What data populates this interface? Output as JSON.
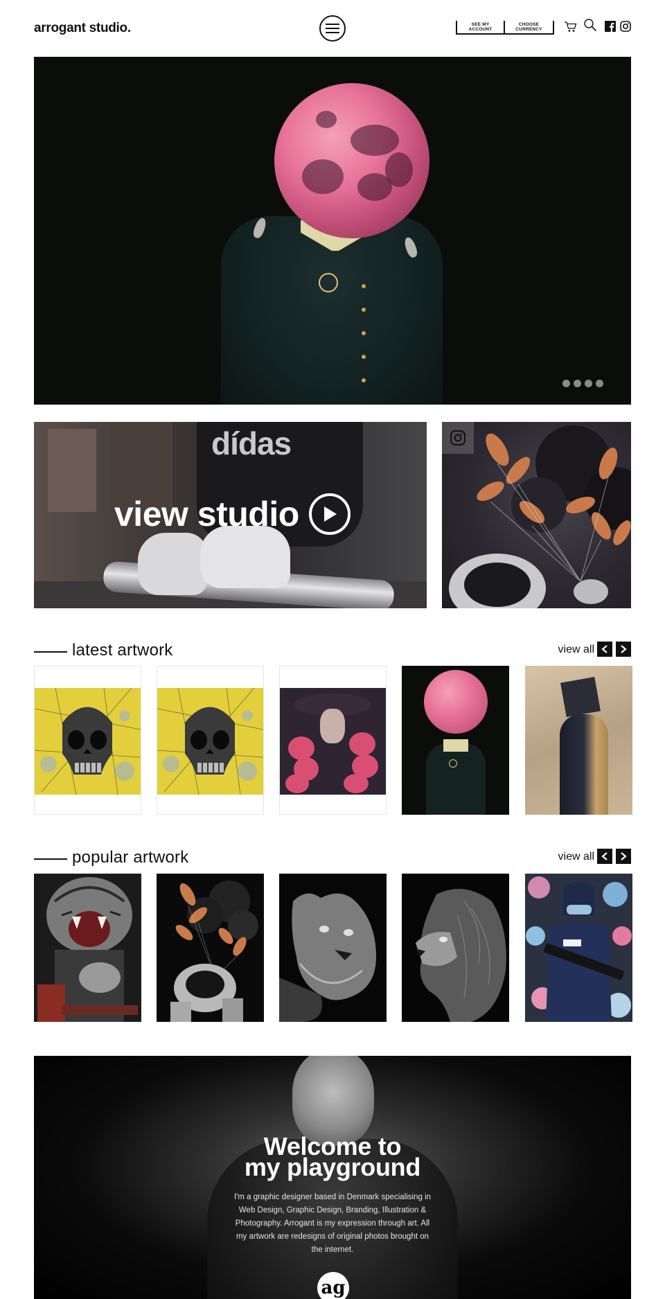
{
  "header": {
    "logo": "arrogant studio.",
    "account_label": "SEE MY\nACCOUNT",
    "currency_label": "CHOOSE\nCURRENCY",
    "icons": [
      "menu-icon",
      "cart-icon",
      "search-icon",
      "facebook-icon",
      "instagram-icon"
    ]
  },
  "hero": {
    "slide_count": 4,
    "active_slide": 1
  },
  "promo": {
    "studio_label": "view studio",
    "instagram_icon": "instagram-icon"
  },
  "latest": {
    "title": "latest artwork",
    "view_all": "view all"
  },
  "popular": {
    "title": "popular artwork",
    "view_all": "view all"
  },
  "welcome": {
    "title_line1": "Welcome to",
    "title_line2": "my playground",
    "text": "I'm a graphic designer based in Denmark specialising in Web Design, Graphic Design, Branding, Illustration & Photography. Arrogant is my expression through art. All my artwork are redesigns of original photos brought on the internet.",
    "logo_text": "ag"
  },
  "colors": {
    "accent": "#111111",
    "background": "#ffffff",
    "moon_pink": "#e8739a",
    "skull_yellow": "#e3cf3c"
  }
}
